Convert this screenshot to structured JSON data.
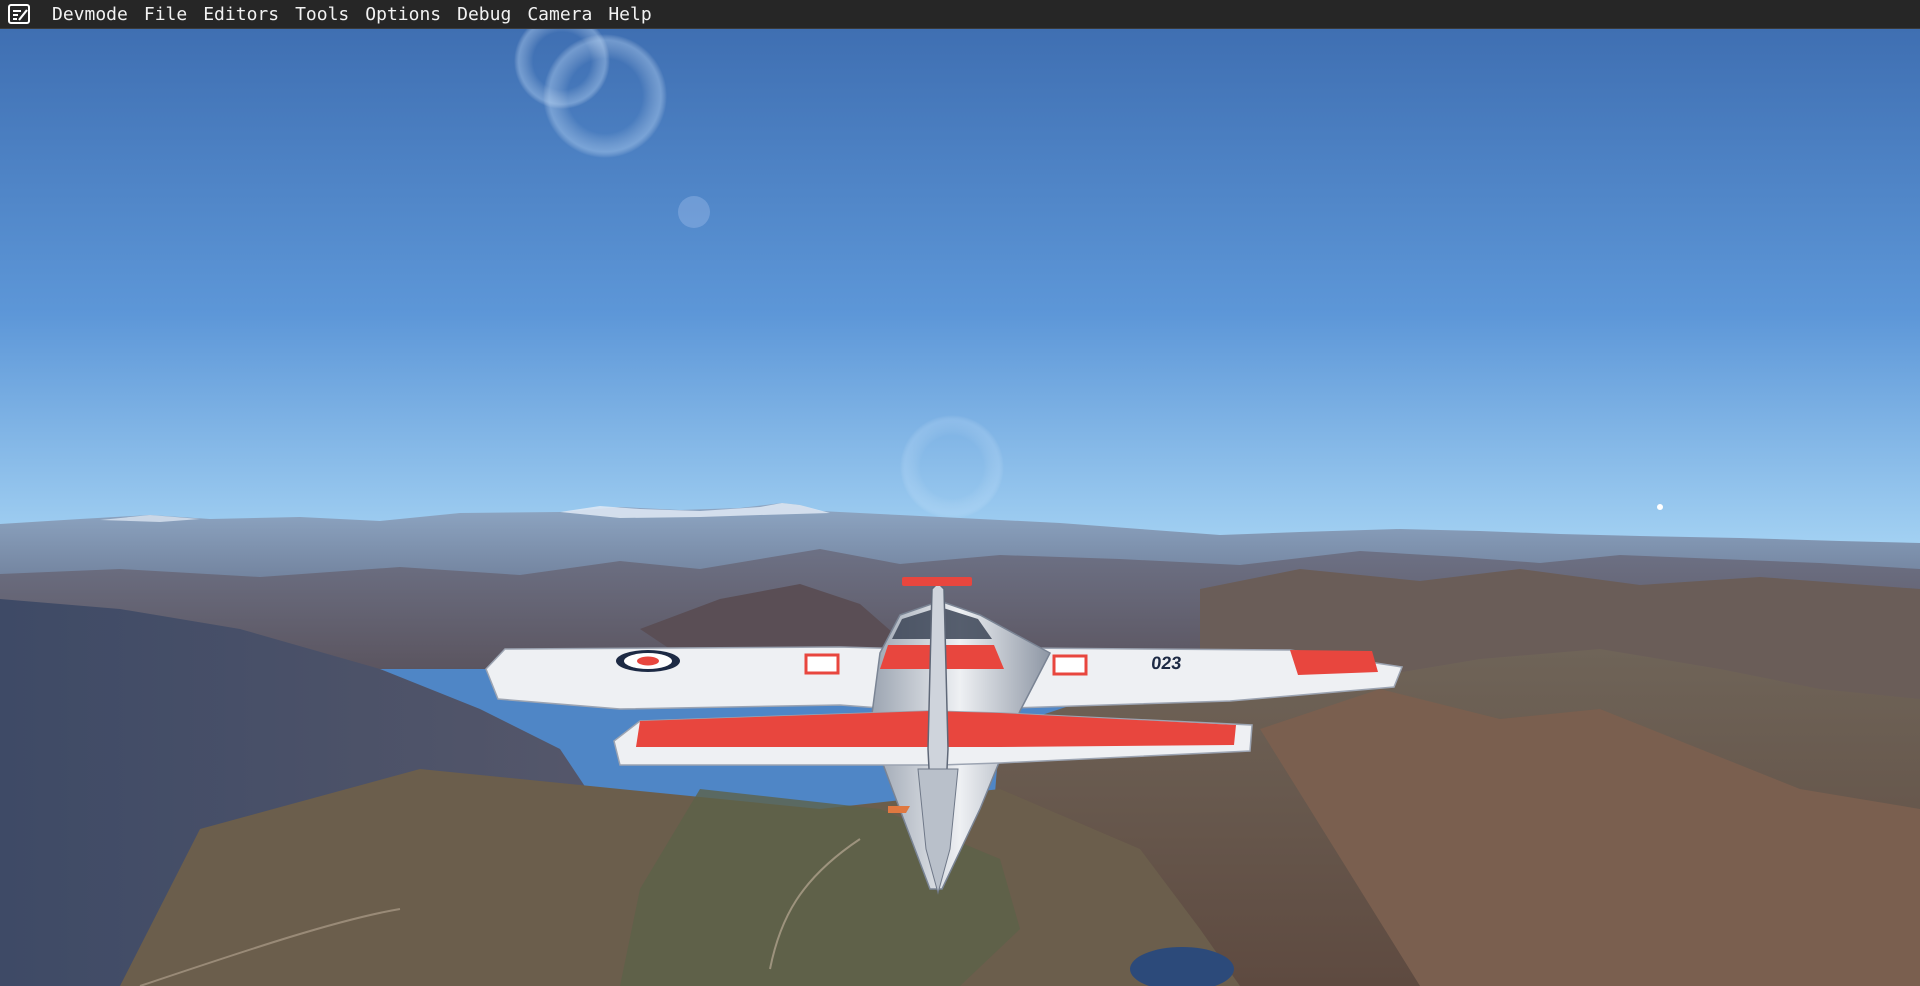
{
  "menubar": {
    "app_icon": "devmode-notepad-icon",
    "items": [
      {
        "label": "Devmode"
      },
      {
        "label": "File"
      },
      {
        "label": "Editors"
      },
      {
        "label": "Tools"
      },
      {
        "label": "Options"
      },
      {
        "label": "Debug"
      },
      {
        "label": "Camera"
      },
      {
        "label": "Help"
      }
    ]
  },
  "scene": {
    "aircraft_registration": "023",
    "roundel_icon": "maple-leaf-roundel-icon",
    "colors": {
      "sky_top": "#3f6fb2",
      "sky_horizon": "#9ccdf2",
      "aircraft_red": "#e8463e",
      "aircraft_white": "#eef0f3",
      "terrain": "#6e5d52"
    }
  }
}
